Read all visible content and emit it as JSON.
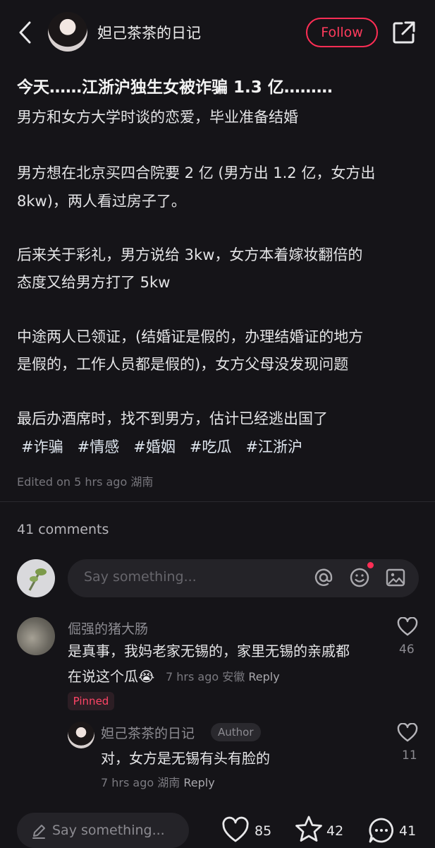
{
  "header": {
    "author_name": "妲己茶茶的日记",
    "follow_label": "Follow"
  },
  "post": {
    "title": "今天……江浙沪独生女被诈骗 1.3 亿………",
    "paragraphs": [
      "男方和女方大学时谈的恋爱，毕业准备结婚",
      "男方想在北京买四合院要 2 亿 (男方出 1.2 亿，女方出",
      "8kw)，两人看过房子了。",
      "后来关于彩礼，男方说给 3kw，女方本着嫁妆翻倍的",
      "态度又给男方打了 5kw",
      "中途两人已领证，(结婚证是假的，办理结婚证的地方",
      "是假的，工作人员都是假的)，女方父母没发现问题",
      "最后办酒席时，找不到男方，估计已经逃出国了"
    ],
    "tags": [
      "#诈骗",
      "#情感",
      "#婚姻",
      "#吃瓜",
      "#江浙沪"
    ],
    "meta": "Edited on 5 hrs ago 湖南"
  },
  "comments_section": {
    "count_label": "41 comments",
    "input_placeholder": "Say something..."
  },
  "comments": [
    {
      "name": "倔强的猪大肠",
      "text_line1": "是真事，我妈老家无锡的，家里无锡的亲戚都",
      "text_line2": "在说这个瓜",
      "emoji": "😭",
      "meta": "7 hrs ago 安徽",
      "reply_label": "Reply",
      "likes": "46",
      "pinned_label": "Pinned",
      "reply": {
        "name": "妲己茶茶的日记",
        "badge": "Author",
        "text": "对，女方是无锡有头有脸的",
        "meta": "7 hrs ago 湖南",
        "reply_label": "Reply",
        "likes": "11"
      }
    }
  ],
  "bottom_bar": {
    "placeholder": "Say something...",
    "like_count": "85",
    "star_count": "42",
    "comment_count": "41"
  },
  "colors": {
    "background": "#151418",
    "accent": "#ff2e55"
  }
}
